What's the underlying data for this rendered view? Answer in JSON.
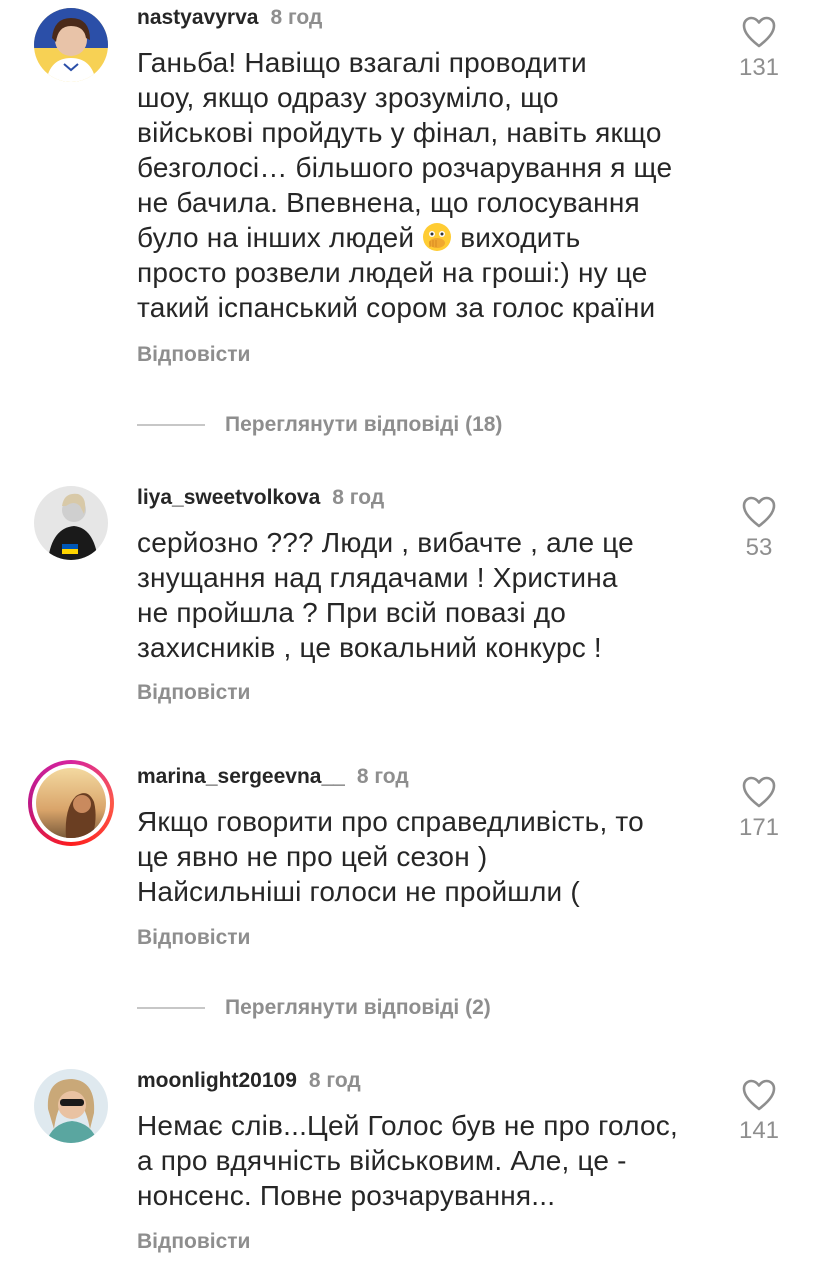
{
  "comments": [
    {
      "username": "nastyavyrva",
      "time": "8 год",
      "lines": [
        "Ганьба! Навіщо взагалі проводити",
        "шоу, якщо одразу зрозуміло, що",
        "військові пройдуть у фінал, навіть якщо",
        "безголосі… більшого розчарування я ще",
        "не бачила. Впевнена, що голосування",
        "було на інших людей",
        "виходить",
        "просто розвели людей на гроші:) ну це",
        "такий іспанський сором за голос країни"
      ],
      "emoji": "flushed-hand-over-mouth-emoji",
      "reply_label": "Відповісти",
      "likes": "131",
      "view_replies": "Переглянути відповіді (18)"
    },
    {
      "username": "liya_sweetvolkova",
      "time": "8 год",
      "lines": [
        "серйозно ??? Люди , вибачте , але це",
        "знущання над глядачами ! Христина",
        "не пройшла ? При всій повазі до",
        "захисників , це вокальний конкурс !"
      ],
      "reply_label": "Відповісти",
      "likes": "53"
    },
    {
      "username": "marina_sergeevna__",
      "time": "8 год",
      "lines": [
        "Якщо говорити про справедливість, то",
        "це явно не про цей сезон )",
        "Найсильніші голоси не пройшли ("
      ],
      "reply_label": "Відповісти",
      "likes": "171",
      "view_replies": "Переглянути відповіді (2)"
    },
    {
      "username": "moonlight20109",
      "time": "8 год",
      "lines": [
        "Немає слів...Цей Голос був не про голос,",
        "а про вдячність військовим. Але, це -",
        "нонсенс. Повне розчарування..."
      ],
      "reply_label": "Відповісти",
      "likes": "141"
    }
  ],
  "icons": {
    "like": "heart-outline-icon"
  },
  "colors": {
    "text": "#262626",
    "secondary": "#8e8e8e",
    "divider": "#c7c7c7"
  }
}
